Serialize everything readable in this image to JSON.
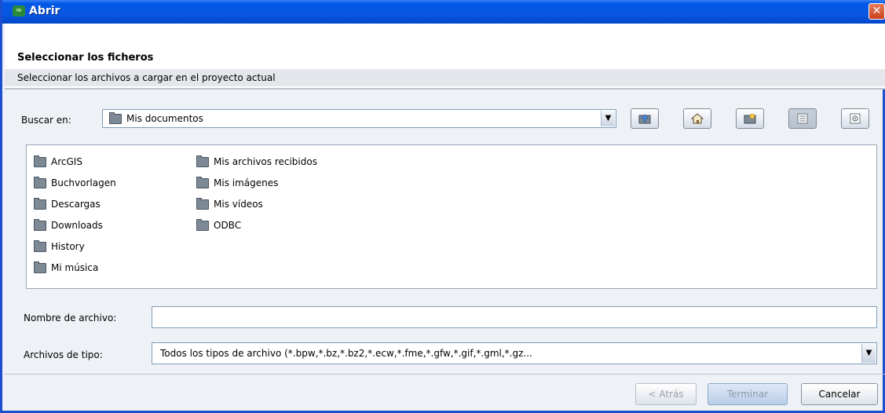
{
  "window": {
    "title": "Abrir"
  },
  "header": {
    "title": "Seleccionar los ficheros",
    "subtitle": "Seleccionar los archivos a cargar en el proyecto actual"
  },
  "lookin": {
    "label": "Buscar en:",
    "value": "Mis documentos"
  },
  "toolbar": {
    "buttons": [
      "up-folder-icon",
      "home-icon",
      "new-folder-icon",
      "list-view-icon",
      "details-view-icon"
    ]
  },
  "files": {
    "col1": [
      "ArcGIS",
      "Buchvorlagen",
      "Descargas",
      "Downloads",
      "History",
      "Mi música"
    ],
    "col2": [
      "Mis archivos recibidos",
      "Mis imágenes",
      "Mis vídeos",
      "ODBC"
    ]
  },
  "filename": {
    "label": "Nombre de archivo:",
    "value": ""
  },
  "filetype": {
    "label": "Archivos de tipo:",
    "value": "Todos los tipos de archivo (*.bpw,*.bz,*.bz2,*.ecw,*.fme,*.gfw,*.gif,*.gml,*.gz..."
  },
  "buttons": {
    "back": "< Atrás",
    "finish": "Terminar",
    "cancel": "Cancelar"
  }
}
